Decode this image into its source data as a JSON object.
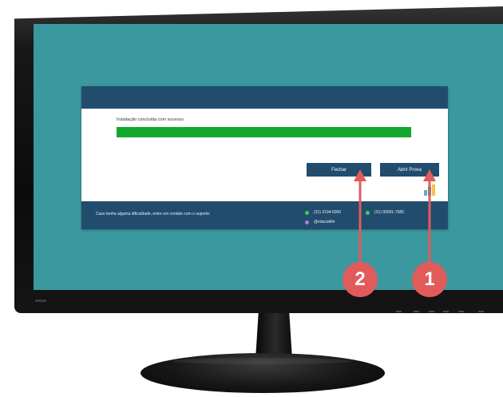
{
  "installer": {
    "status_text": "Instalação concluída com sucesso",
    "progress_percent": 100,
    "buttons": {
      "close_label": "Fechar",
      "open_label": "Abrir Prova"
    },
    "footer": {
      "message": "Caso tenha alguma dificuldade, entre em contato com o suporte:",
      "phone_1": "(31) 3194-6900",
      "phone_2": "(31) 99991-7585",
      "social": "@educatlife"
    }
  },
  "annotations": {
    "marker_1": "1",
    "marker_2": "2",
    "color": "#e15b5b"
  },
  "colors": {
    "screen_background": "#3b989e",
    "installer_header": "#224c6d",
    "progress_fill": "#12a82e"
  }
}
